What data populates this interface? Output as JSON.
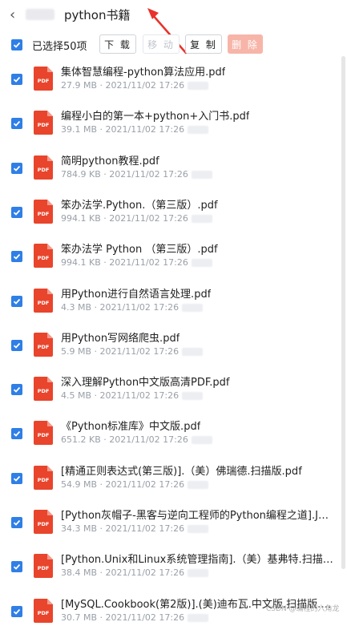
{
  "header": {
    "title": "python书籍"
  },
  "toolbar": {
    "selected_label": "已选择50项",
    "download_label": "下 载",
    "move_label": "移 动",
    "copy_label": "复 制",
    "delete_label": "删 除"
  },
  "colors": {
    "checkbox": "#2f7fe6",
    "pdf_icon": "#e8452c",
    "delete_button": "#f7b5a9",
    "arrow": "#e8322b"
  },
  "files": [
    {
      "name": "集体智慧编程-python算法应用.pdf",
      "meta": "27.9 MB · 2021/11/02 17:26"
    },
    {
      "name": "编程小白的第一本+python+入门书.pdf",
      "meta": "39.1 MB · 2021/11/02 17:26"
    },
    {
      "name": "简明python教程.pdf",
      "meta": "784.9 KB · 2021/11/02 17:26"
    },
    {
      "name": "笨办法学.Python.（第三版）.pdf",
      "meta": "994.1 KB · 2021/11/02 17:26"
    },
    {
      "name": "笨办法学 Python （第三版）.pdf",
      "meta": "994.1 KB · 2021/11/02 17:26"
    },
    {
      "name": "用Python进行自然语言处理.pdf",
      "meta": "4.3 MB · 2021/11/02 17:26"
    },
    {
      "name": "用Python写网络爬虫.pdf",
      "meta": "5.9 MB · 2021/11/02 17:26"
    },
    {
      "name": "深入理解Python中文版高清PDF.pdf",
      "meta": "4.5 MB · 2021/11/02 17:26"
    },
    {
      "name": "《Python标准库》中文版.pdf",
      "meta": "651.2 KB · 2021/11/02 17:26"
    },
    {
      "name": "[精通正则表达式(第三版)].（美）佛瑞德.扫描版.pdf",
      "meta": "54.9 MB · 2021/11/02 17:26"
    },
    {
      "name": "[Python灰帽子-黑客与逆向工程师的Python编程之道].Ju...",
      "meta": "34.3 MB · 2021/11/02 17:26"
    },
    {
      "name": "[Python.Unix和Linux系统管理指南].（美）基弗特.扫描版...",
      "meta": "38.4 MB · 2021/11/02 17:26"
    },
    {
      "name": "[MySQL.Cookbook(第2版)].(美)迪布瓦.中文版.扫描版.pdf",
      "meta": "30.7 MB · 2021/11/02 17:26"
    }
  ],
  "pdf_icon_label": "PDF",
  "watermark": "CSDN @编程的六角龙"
}
